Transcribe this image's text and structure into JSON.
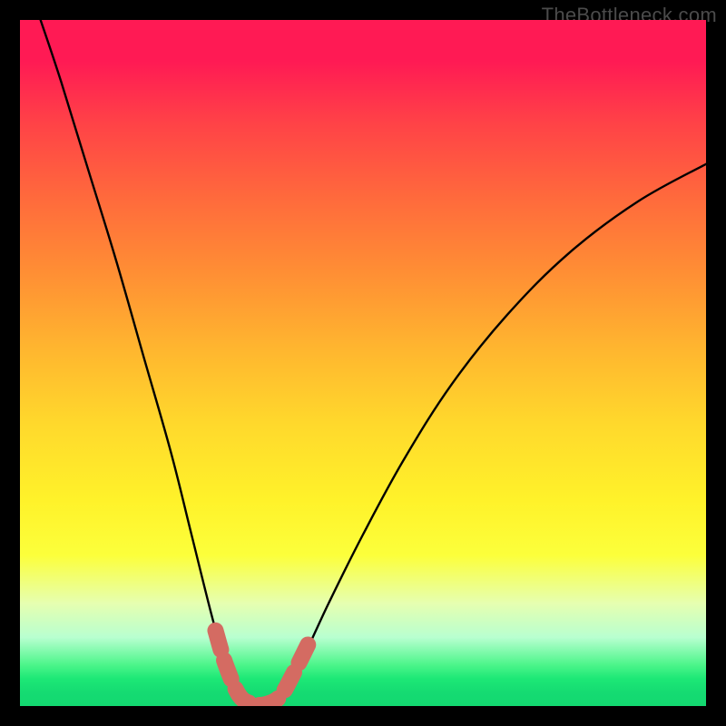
{
  "watermark": "TheBottleneck.com",
  "colors": {
    "frame": "#000000",
    "curve_primary": "#000000",
    "curve_highlight": "#d46b62",
    "gradient_top": "#ff1a54",
    "gradient_mid": "#ffd92c",
    "gradient_bottom": "#13d870"
  },
  "chart_data": {
    "type": "line",
    "title": "",
    "xlabel": "",
    "ylabel": "",
    "xlim": [
      0,
      100
    ],
    "ylim": [
      0,
      100
    ],
    "legend": false,
    "grid": false,
    "note": "Axes have no visible tick labels; x and y are normalized 0–100 from the plotting area. Curve is a pronounced V/valley shape with minimum near x≈34; left arm rises to top-left corner, right arm rises toward upper-right. The coral dashed overlay traces the bottom of the valley from roughly x≈29 to x≈42 at y≈0–8.",
    "series": [
      {
        "name": "valley-curve",
        "style": "solid-black",
        "points": [
          {
            "x": 3.0,
            "y": 100.0
          },
          {
            "x": 6.0,
            "y": 91.0
          },
          {
            "x": 10.0,
            "y": 78.0
          },
          {
            "x": 14.0,
            "y": 65.0
          },
          {
            "x": 18.0,
            "y": 51.0
          },
          {
            "x": 22.0,
            "y": 37.0
          },
          {
            "x": 25.0,
            "y": 25.0
          },
          {
            "x": 28.0,
            "y": 13.0
          },
          {
            "x": 30.0,
            "y": 6.0
          },
          {
            "x": 32.0,
            "y": 1.5
          },
          {
            "x": 34.0,
            "y": 0.3
          },
          {
            "x": 36.0,
            "y": 0.3
          },
          {
            "x": 38.0,
            "y": 1.5
          },
          {
            "x": 41.0,
            "y": 6.5
          },
          {
            "x": 45.0,
            "y": 15.0
          },
          {
            "x": 50.0,
            "y": 25.0
          },
          {
            "x": 56.0,
            "y": 36.0
          },
          {
            "x": 63.0,
            "y": 47.0
          },
          {
            "x": 71.0,
            "y": 57.0
          },
          {
            "x": 80.0,
            "y": 66.0
          },
          {
            "x": 90.0,
            "y": 73.5
          },
          {
            "x": 100.0,
            "y": 79.0
          }
        ]
      },
      {
        "name": "valley-bottom-highlight",
        "style": "dashed-coral-thick",
        "points": [
          {
            "x": 28.5,
            "y": 11.0
          },
          {
            "x": 30.0,
            "y": 6.0
          },
          {
            "x": 32.0,
            "y": 1.5
          },
          {
            "x": 34.0,
            "y": 0.3
          },
          {
            "x": 36.0,
            "y": 0.3
          },
          {
            "x": 38.0,
            "y": 1.5
          },
          {
            "x": 40.0,
            "y": 5.0
          },
          {
            "x": 42.0,
            "y": 9.0
          }
        ]
      }
    ]
  }
}
